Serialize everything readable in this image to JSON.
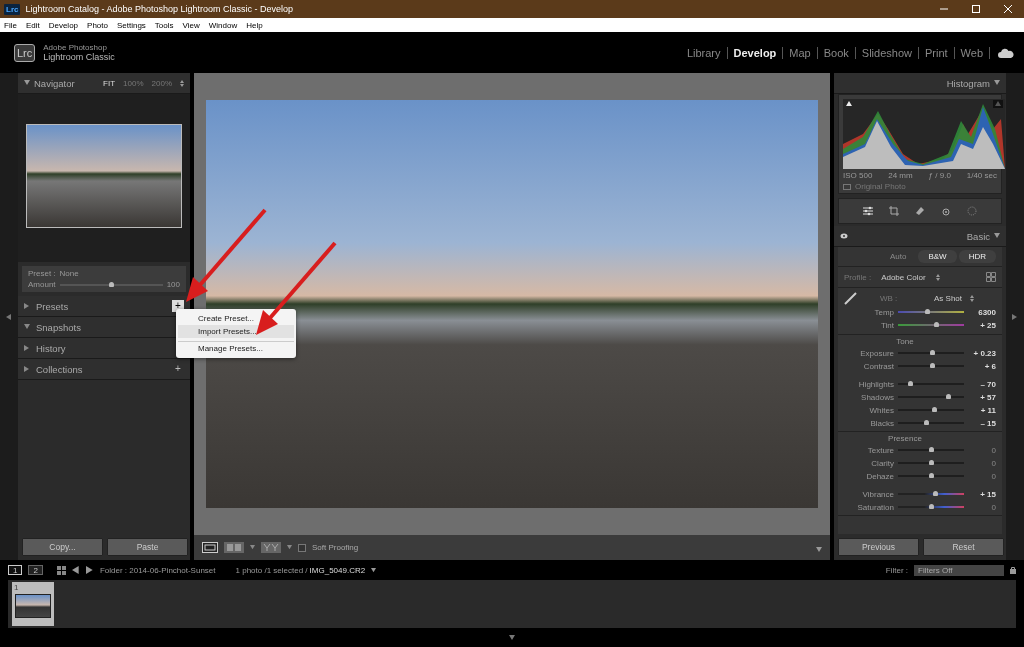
{
  "window": {
    "title": "Lightroom Catalog - Adobe Photoshop Lightroom Classic - Develop",
    "logo": "Lrc"
  },
  "menu_bar": [
    "File",
    "Edit",
    "Develop",
    "Photo",
    "Settings",
    "Tools",
    "View",
    "Window",
    "Help"
  ],
  "identity": {
    "logo": "Lrc",
    "brand_small": "Adobe Photoshop",
    "brand": "Lightroom Classic"
  },
  "modules": [
    {
      "label": "Library",
      "selected": false
    },
    {
      "label": "Develop",
      "selected": true
    },
    {
      "label": "Map",
      "selected": false
    },
    {
      "label": "Book",
      "selected": false
    },
    {
      "label": "Slideshow",
      "selected": false
    },
    {
      "label": "Print",
      "selected": false
    },
    {
      "label": "Web",
      "selected": false
    }
  ],
  "left_panel": {
    "navigator": {
      "title": "Navigator",
      "zoom_options": [
        {
          "label": "FIT",
          "selected": true
        },
        {
          "label": "100%",
          "selected": false
        },
        {
          "label": "200%",
          "selected": false
        }
      ]
    },
    "preset_amount": {
      "preset_label": "Preset :",
      "preset_value": "None",
      "amount_label": "Amount",
      "level": 0.5,
      "reading": "100"
    },
    "panels": [
      {
        "title": "Presets",
        "expanded": false,
        "add_button": "+"
      },
      {
        "title": "Snapshots",
        "expanded": true
      },
      {
        "title": "History",
        "expanded": false
      },
      {
        "title": "Collections",
        "expanded": false,
        "add_button": "+"
      }
    ],
    "buttons": [
      "Copy...",
      "Paste"
    ]
  },
  "context_menu": {
    "items": [
      {
        "label": "Create Preset...",
        "selected": false,
        "divider_above": false
      },
      {
        "label": "Import Presets...",
        "selected": true,
        "divider_above": false
      },
      {
        "label": "Manage Presets...",
        "selected": false,
        "divider_above": true
      }
    ]
  },
  "toolbar": {
    "soft_proofing": {
      "label": "Soft Proofing",
      "checked": false
    }
  },
  "right_panel": {
    "histogram": {
      "title": "Histogram",
      "readings": [
        "ISO 500",
        "24 mm",
        "ƒ / 9.0",
        "1/40 sec"
      ],
      "original_photo": {
        "label": "Original Photo",
        "checked": false
      }
    },
    "basic": {
      "title": "Basic",
      "treatments": [
        {
          "label": "Auto",
          "disabled": true
        },
        {
          "label": "B&W",
          "disabled": false
        },
        {
          "label": "HDR",
          "disabled": false
        }
      ],
      "profile_label": "Profile :",
      "profile_value": "Adobe Color",
      "wb_label": "WB :",
      "wb_value": "As Shot",
      "wb_sliders": [
        {
          "name": "Temp",
          "level": 0.45,
          "reading": "6300",
          "kind": "temp"
        },
        {
          "name": "Tint",
          "level": 0.59,
          "reading": "+ 25",
          "kind": "tint"
        }
      ],
      "sections": [
        {
          "title": "Tone",
          "groups": [
            [
              {
                "name": "Exposure",
                "level": 0.53,
                "reading": "+ 0.23",
                "kind": "plain"
              },
              {
                "name": "Contrast",
                "level": 0.53,
                "reading": "+ 6",
                "kind": "plain"
              }
            ],
            [
              {
                "name": "Highlights",
                "level": 0.19,
                "reading": "– 70",
                "kind": "plain"
              },
              {
                "name": "Shadows",
                "level": 0.76,
                "reading": "+ 57",
                "kind": "plain"
              },
              {
                "name": "Whites",
                "level": 0.55,
                "reading": "+ 11",
                "kind": "plain"
              },
              {
                "name": "Blacks",
                "level": 0.43,
                "reading": "– 15",
                "kind": "plain"
              }
            ]
          ]
        },
        {
          "title": "Presence",
          "groups": [
            [
              {
                "name": "Texture",
                "level": 0.51,
                "reading": "0",
                "kind": "plain"
              },
              {
                "name": "Clarity",
                "level": 0.51,
                "reading": "0",
                "kind": "plain"
              },
              {
                "name": "Dehaze",
                "level": 0.51,
                "reading": "0",
                "kind": "plain"
              }
            ],
            [
              {
                "name": "Vibrance",
                "level": 0.57,
                "reading": "+ 15",
                "kind": "color"
              },
              {
                "name": "Saturation",
                "level": 0.51,
                "reading": "0",
                "kind": "color"
              }
            ]
          ]
        }
      ]
    },
    "buttons": [
      "Previous",
      "Reset"
    ]
  },
  "filmstrip": {
    "monitors": [
      {
        "label": "1",
        "selected": true
      },
      {
        "label": "2",
        "selected": false
      }
    ],
    "folder": "Folder : 2014-06-Pinchot-Sunset",
    "count": "1 photo /1 selected /",
    "file": "IMG_5049.CR2",
    "filter_label": "Filter :",
    "filter_value": "Filters Off",
    "thumbnails": [
      {
        "number": "1",
        "selected": true
      }
    ]
  }
}
